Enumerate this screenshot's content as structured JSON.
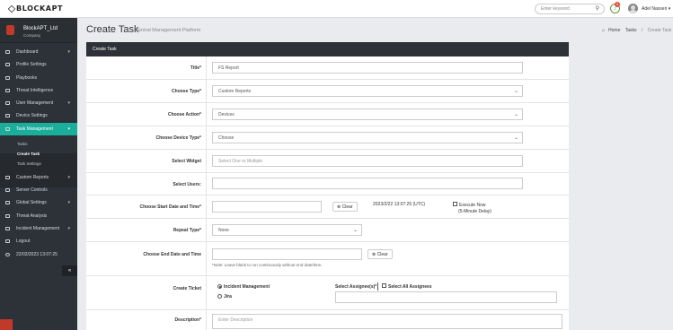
{
  "header": {
    "logo": "BLOCKAPT",
    "search_placeholder": "Enter keyword",
    "notification_count": "0",
    "user_name": "Adel Nasseri"
  },
  "sidebar": {
    "company_name": "BlockAPT_Ltd",
    "company_sub": "Company",
    "items": [
      {
        "label": "Dashboard",
        "chevron": "▾"
      },
      {
        "label": "Profile Settings"
      },
      {
        "label": "Playbooks"
      },
      {
        "label": "Threat Intelligence"
      },
      {
        "label": "User Management",
        "chevron": "▾"
      },
      {
        "label": "Device Settings"
      },
      {
        "label": "Task Management",
        "chevron": "▾"
      },
      {
        "label": "Custom Reports",
        "chevron": "▾"
      },
      {
        "label": "Server Controls"
      },
      {
        "label": "Global Settings",
        "chevron": "▾"
      },
      {
        "label": "Threat Analysis"
      },
      {
        "label": "Incident Management",
        "chevron": "▾"
      },
      {
        "label": "Logout"
      },
      {
        "label": "22/02/2023 13:07:25"
      }
    ],
    "sub_items": [
      "Tasks",
      "Create Task",
      "Task Settings"
    ],
    "collapse": "«"
  },
  "page": {
    "title": "Create Task",
    "subtitle": "Central Management Platform",
    "breadcrumb": [
      "Home",
      "Tasks",
      "Create Task"
    ]
  },
  "form": {
    "card_title": "Create Task",
    "title_label": "Title*",
    "title_value": "FS Report",
    "type_label": "Choose Type*",
    "type_value": "Custom Reports",
    "action_label": "Choose Action*",
    "action_value": "Devices",
    "device_type_label": "Choose Device Type*",
    "device_type_value": "Choose",
    "widget_label": "Select Widget",
    "widget_placeholder": "Select One or Multiple",
    "users_label": "Select Users:",
    "start_label": "Choose Start Date and Time*",
    "clear_label": "Clear",
    "start_display": "2023/2/22 13:07:25 (UTC)",
    "execute_now": "Execute Now",
    "execute_note": "(5-Minute Delay)",
    "repeat_label": "Repeat Type*",
    "repeat_value": "None",
    "end_label": "Choose End Date and Time",
    "end_note": "*Note: Leave blank to run continuously without end date/time.",
    "ticket_label": "Create Ticket",
    "ticket_opt1": "Incident Management",
    "ticket_opt2": "Jira",
    "assignee_label": "Select Assignee(s)*",
    "all_assignees": "Select All Assignees",
    "desc_label": "Description*",
    "desc_placeholder": "Enter Description"
  }
}
